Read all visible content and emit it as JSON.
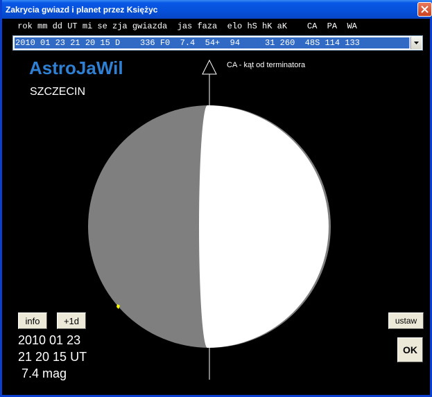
{
  "window": {
    "title": "Zakrycia gwiazd i planet przez Księżyc",
    "close_icon": "close-icon"
  },
  "table": {
    "header": " rok mm dd UT mi se zja gwiazda  jas faza  elo hS hK aK    CA  PA  WA",
    "selected_row": "2010 01 23 21 20 15 D    336 F0  7.4  54+  94     31 260  48S 114 133"
  },
  "brand": "AstroJaWil",
  "city": "SZCZECIN",
  "ca_label": "CA - kąt od terminatora",
  "buttons": {
    "info": "info",
    "plus_day": "+1d",
    "ustaw": "ustaw",
    "ok": "OK"
  },
  "event": {
    "date": "2010 01 23",
    "time": "21 20 15 UT",
    "magnitude": " 7.4 mag"
  },
  "colors": {
    "lit": "#ffffff",
    "dark_side": "#7f7f7f",
    "star_marker": "#ffff00",
    "brand": "#2f7fd2",
    "titlebar": "#0650d9"
  }
}
